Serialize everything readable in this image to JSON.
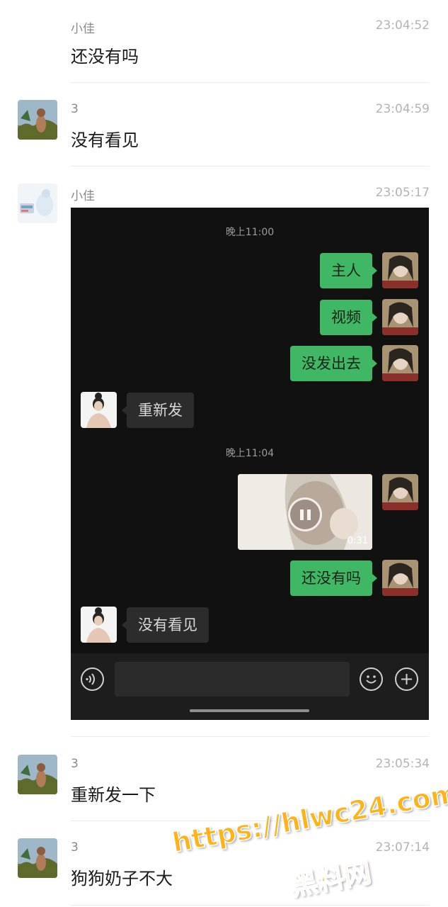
{
  "messages": [
    {
      "name": "小佳",
      "time": "23:04:52",
      "text": "还没有吗"
    },
    {
      "name": "3",
      "time": "23:04:59",
      "text": "没有看见"
    },
    {
      "name": "小佳",
      "time": "23:05:17"
    },
    {
      "name": "3",
      "time": "23:05:34",
      "text": "重新发一下"
    },
    {
      "name": "3",
      "time": "23:07:14",
      "text": "狗狗奶子不大"
    }
  ],
  "screenshot": {
    "time1": "晚上11:00",
    "time2": "晚上11:04",
    "bubbles": [
      "主人",
      "视频",
      "没发出去",
      "重新发",
      "还没有吗",
      "没有看见"
    ],
    "video_duration": "0:31"
  },
  "watermark": {
    "url": "https://hlwc24.com",
    "site": "黑料网"
  },
  "colors": {
    "bubble_green": "#3fb764",
    "screenshot_bg": "#111111",
    "watermark": "#ffb31a"
  },
  "icons": [
    "voice-icon",
    "emoji-icon",
    "plus-icon",
    "play-pause-icon"
  ]
}
